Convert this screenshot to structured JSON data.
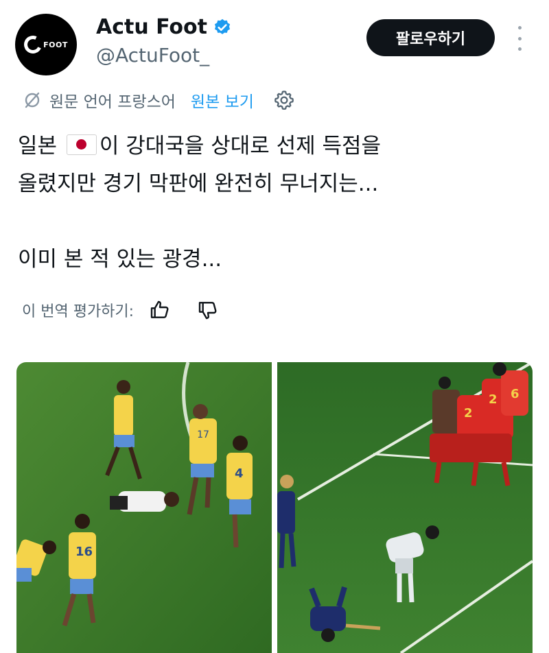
{
  "account": {
    "name": "Actu Foot",
    "handle": "@ActuFoot_",
    "avatar_text": "FOOT",
    "verified_color": "#1d9bf0"
  },
  "follow_button": {
    "label": "팔로우하기"
  },
  "translation": {
    "source_label": "원문 언어 프랑스어",
    "view_original": "원본 보기"
  },
  "tweet": {
    "line1_before_flag": "일본",
    "line1_after_flag": "이 강대국을 상대로 선제 득점을",
    "line2": "올렸지만 경기 막판에 완전히 무너지는...",
    "line3": "이미 본 적 있는 광경..."
  },
  "rating": {
    "label": "이 번역 평가하기:"
  },
  "media": {
    "left": {
      "jersey_numbers": [
        "17",
        "4",
        "16"
      ]
    },
    "right": {
      "jersey_numbers": [
        "6",
        "2",
        "2"
      ]
    }
  },
  "colors": {
    "pitch": "#3e7a2c",
    "brazil_yellow": "#f4d34a",
    "korea_red": "#d92a25",
    "japan_blue": "#1e2d6b"
  }
}
